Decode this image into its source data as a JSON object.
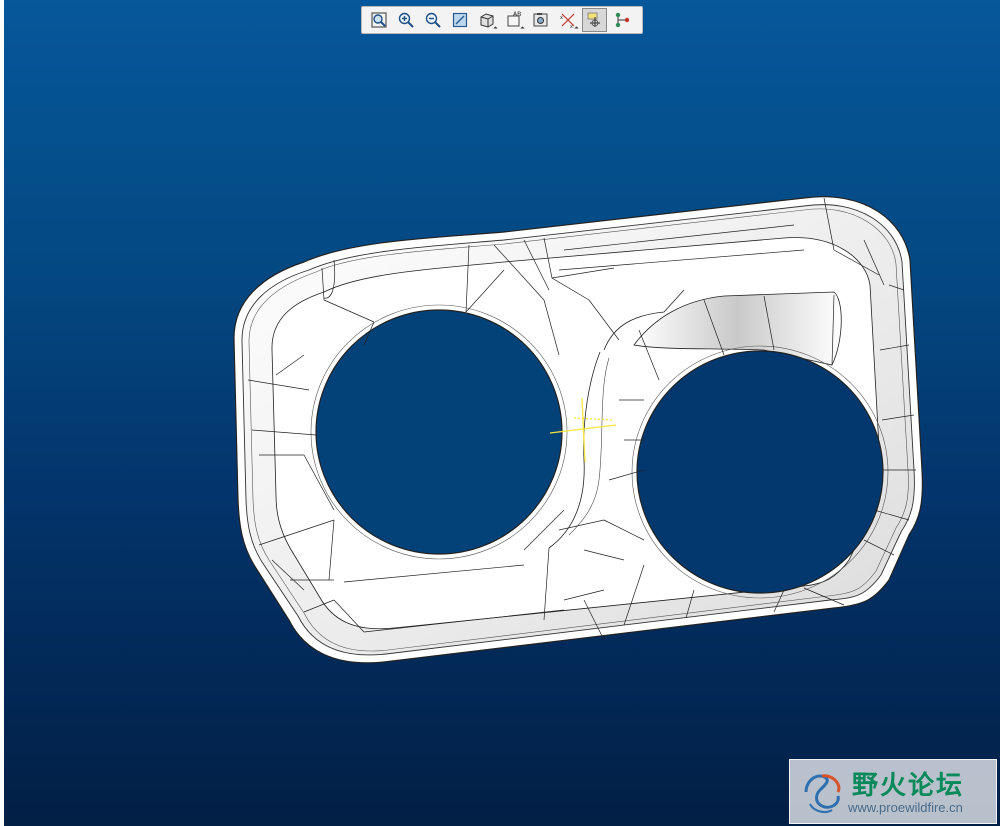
{
  "toolbar": {
    "buttons": [
      {
        "name": "zoom-fit-icon",
        "tooltip": "Refit"
      },
      {
        "name": "zoom-in-icon",
        "tooltip": "Zoom In"
      },
      {
        "name": "zoom-out-icon",
        "tooltip": "Zoom Out"
      },
      {
        "name": "repaint-icon",
        "tooltip": "Repaint"
      },
      {
        "name": "display-style-icon",
        "tooltip": "Display Style"
      },
      {
        "name": "saved-views-icon",
        "tooltip": "Saved Orientations"
      },
      {
        "name": "view-manager-icon",
        "tooltip": "View Manager"
      },
      {
        "name": "datum-display-icon",
        "tooltip": "Datum Display"
      },
      {
        "name": "spin-center-icon",
        "tooltip": "Spin Center"
      },
      {
        "name": "annotation-display-icon",
        "tooltip": "Annotation Display"
      }
    ],
    "active_index": 8
  },
  "watermark": {
    "title": "野火论坛",
    "url": "www.proewildfire.cn"
  },
  "colors": {
    "viewport_top": "#06579b",
    "viewport_bottom": "#021f45",
    "spin_center": "#f5e63a"
  }
}
